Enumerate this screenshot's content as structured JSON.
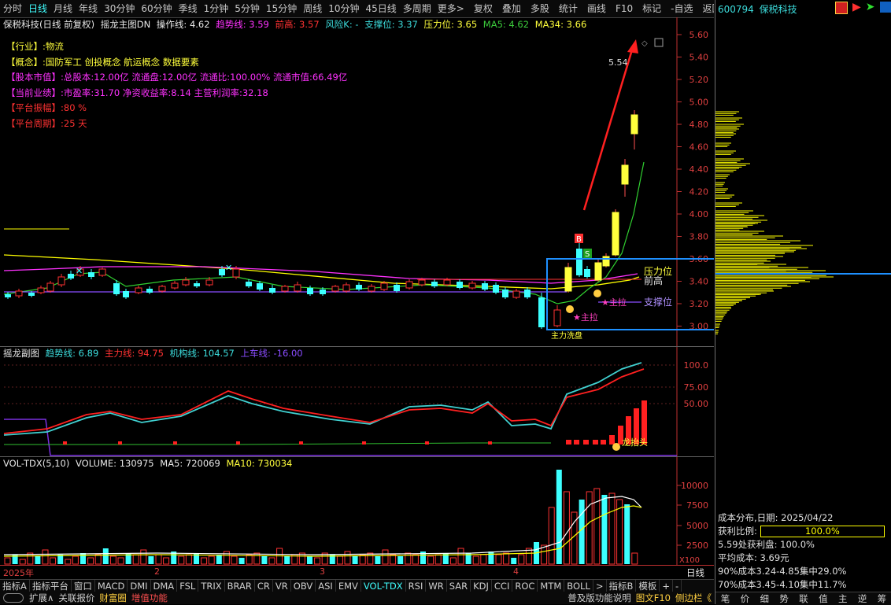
{
  "toolbar": {
    "left": [
      "分时",
      "日线",
      "月线",
      "年线",
      "30分钟",
      "60分钟",
      "季线",
      "1分钟",
      "5分钟",
      "15分钟",
      "周线",
      "10分钟",
      "45日线",
      "多周期",
      "更多>"
    ],
    "active": "日线",
    "right": [
      "复权",
      "叠加",
      "多股",
      "统计",
      "画线",
      "F10",
      "标记",
      "-自选",
      "返回"
    ]
  },
  "stock_header": {
    "code": "600794",
    "name": "保税科技"
  },
  "main_info": {
    "title": "保税科技(日线 前复权)",
    "indicator": "摇龙主图DN",
    "op_line": "操作线: 4.62",
    "trend_line": "趋势线: 3.59",
    "prev_high": "前高: 3.57",
    "risk": "风险K: -",
    "support": "支撑位: 3.37",
    "pressure": "压力位: 3.65",
    "ma5": "MA5: 4.62",
    "ma34": "MA34: 3.66"
  },
  "stock_notes": [
    {
      "label": "【行业】:",
      "value": "物流",
      "lc": "yel",
      "vc": "yel"
    },
    {
      "label": "【概念】:",
      "value": "国防军工 创投概念 航运概念 数据要素",
      "lc": "yel",
      "vc": "yel"
    },
    {
      "label": "【股本市值】:",
      "value": "总股本:12.00亿 流通盘:12.00亿 流通比:100.00% 流通市值:66.49亿",
      "lc": "mag",
      "vc": "mag"
    },
    {
      "label": "【当前业绩】:",
      "value": "市盈率:31.70 净资收益率:8.14 主营利润率:32.18",
      "lc": "mag",
      "vc": "mag"
    },
    {
      "label": "【平台振幅】:",
      "value": "80 %",
      "lc": "red",
      "vc": "red"
    },
    {
      "label": "【平台周期】:",
      "value": "25 天",
      "lc": "red",
      "vc": "red"
    }
  ],
  "price_axis": [
    "5.60",
    "5.40",
    "5.20",
    "5.00",
    "4.80",
    "4.60",
    "4.40",
    "4.20",
    "4.00",
    "3.80",
    "3.60",
    "3.40",
    "3.20",
    "3.00"
  ],
  "chart_annotations": {
    "max_price": "5.54",
    "pressure_label": "压力位",
    "prev_high_label": "前高",
    "support_label": "支撑位",
    "main_pull_1": "★主拉",
    "main_pull_2": "★主拉",
    "main_washout": "主力洗盘",
    "buy_mark": "B",
    "sell_mark": "S",
    "event_1": "财",
    "event_2": "减",
    "event_3": "跌",
    "event_4": "涨榜"
  },
  "osc_info": {
    "title": "摇龙副图",
    "trend": "趋势线: 6.89",
    "main": "主力线: 94.75",
    "inst": "机构线: 104.57",
    "board": "上车线: -16.00",
    "axis": [
      "100.0",
      "75.00",
      "50.00"
    ],
    "dragon_label": "龙抬头"
  },
  "vol_info": {
    "title": "VOL-TDX(5,10)",
    "volume": "VOLUME: 130975",
    "ma5": "MA5: 720069",
    "ma10": "MA10: 730034",
    "axis": [
      "10000",
      "7500",
      "5000",
      "2500"
    ],
    "unit": "X100"
  },
  "date_axis": {
    "year": "2025年",
    "months": [
      "2",
      "3",
      "4"
    ],
    "period": "日线"
  },
  "bottom_tabs_1": [
    "指标A",
    "指标平台",
    "窗口",
    "MACD",
    "DMI",
    "DMA",
    "FSL",
    "TRIX",
    "BRAR",
    "CR",
    "VR",
    "OBV",
    "ASI",
    "EMV",
    "VOL-TDX",
    "RSI",
    "WR",
    "SAR",
    "KDJ",
    "CCI",
    "ROC",
    "MTM",
    "BOLL",
    ">",
    "指标B",
    "模板",
    "+",
    "-"
  ],
  "bottom_tabs_1_active": "VOL-TDX",
  "bottom_tabs_2": [
    "扩展∧",
    "关联报价",
    "财富圈",
    "增值功能"
  ],
  "bottom_right_links": [
    "普及版功能说明",
    "图文F10",
    "侧边栏《"
  ],
  "cost_distribution": {
    "title": "成本分布,日期: 2025/04/22",
    "profit_label": "获利比例:",
    "profit_value": "100.0%",
    "profit_price": "5.59处获利盘: 100.0%",
    "avg_cost": "平均成本: 3.69元",
    "cost_90": "90%成本3.24-4.85集中29.0%",
    "cost_70": "70%成本3.45-4.10集中11.7%"
  },
  "right_tabs": [
    "笔",
    "价",
    "细",
    "势",
    "联",
    "值",
    "主",
    "逆",
    "筹"
  ],
  "colors": {
    "up": "#ff3232",
    "down": "#3cffff",
    "ma5": "#ffffff",
    "ma34": "#ffff00",
    "trend": "#ff32ff",
    "highlight_box": "#1e90ff",
    "chip": "#ffff00"
  }
}
